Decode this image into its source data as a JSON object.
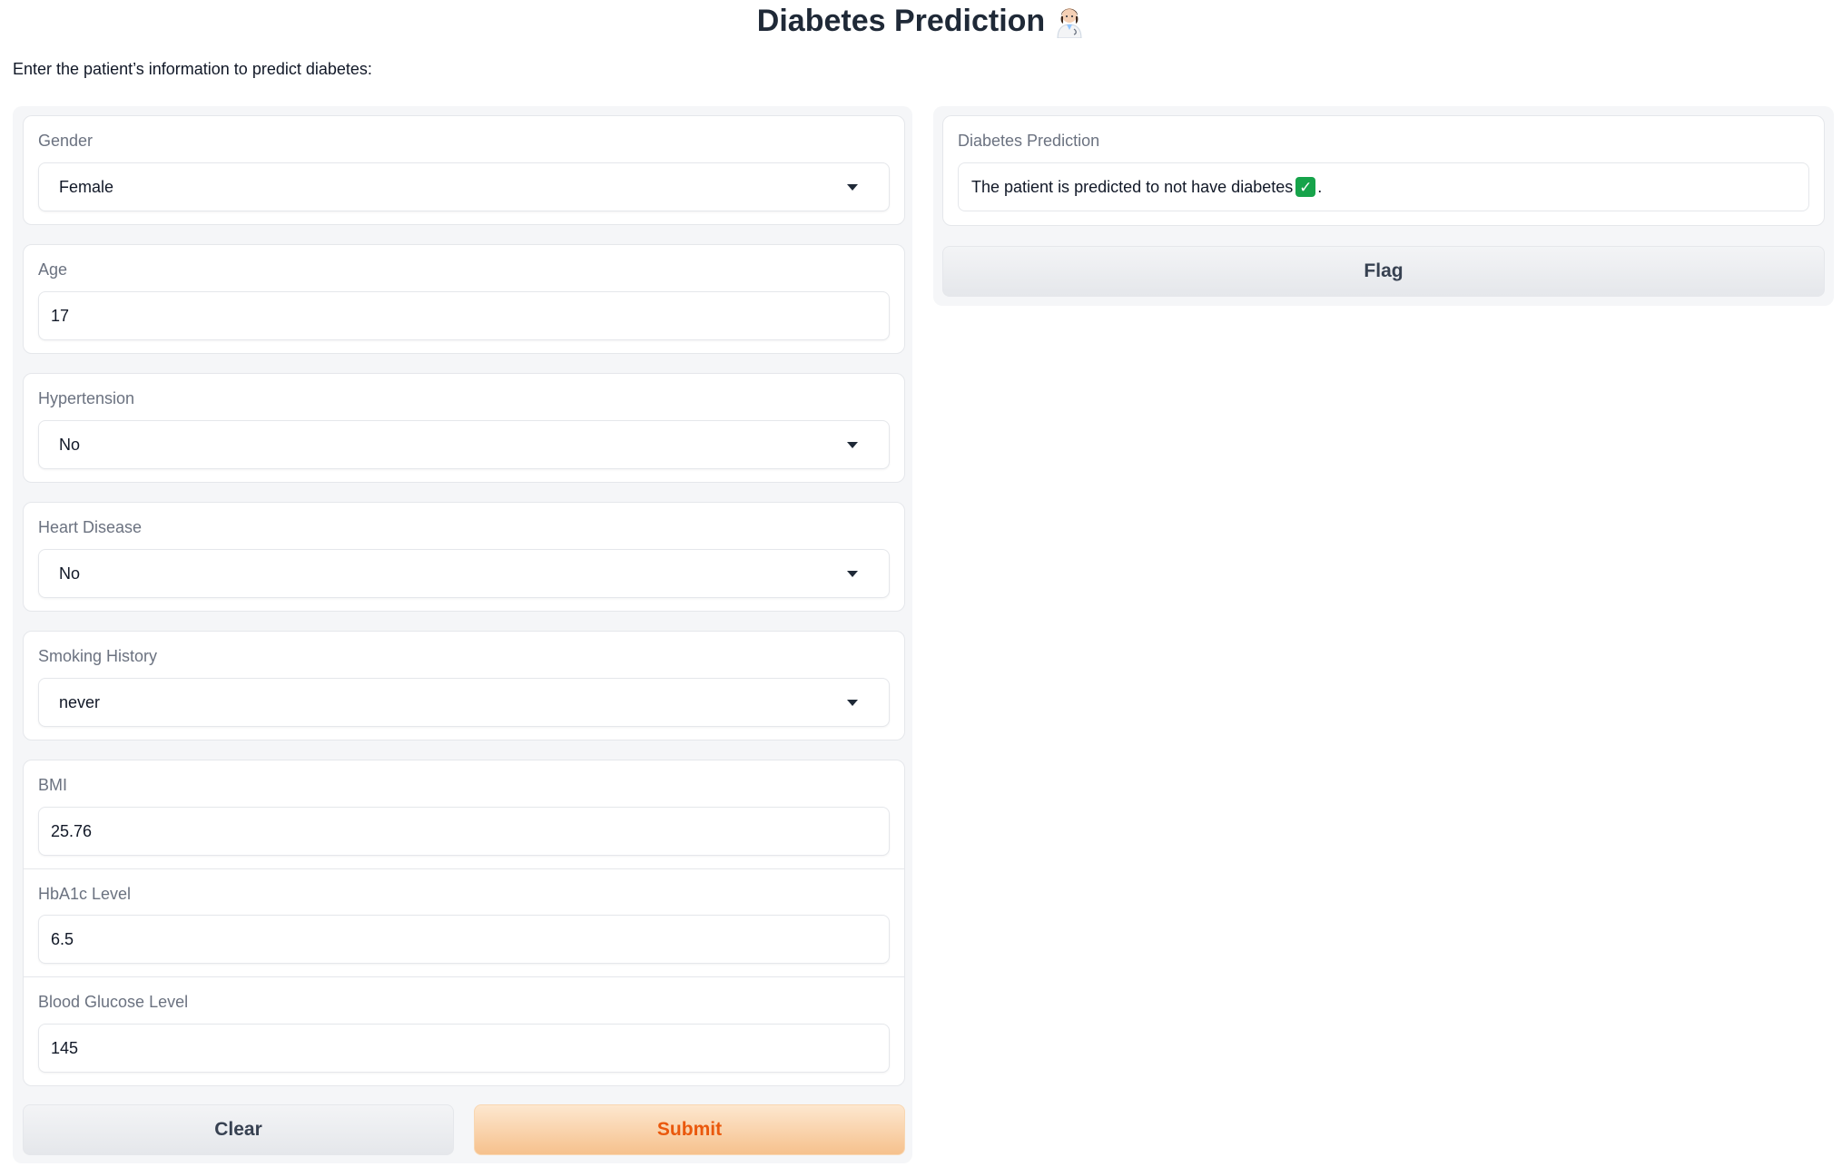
{
  "header": {
    "title": "Diabetes Prediction",
    "title_icon": "woman-health-worker-icon",
    "subtitle": "Enter the patient’s information to predict diabetes:"
  },
  "form": {
    "gender": {
      "label": "Gender",
      "value": "Female"
    },
    "age": {
      "label": "Age",
      "value": "17"
    },
    "hypertension": {
      "label": "Hypertension",
      "value": "No"
    },
    "heart_disease": {
      "label": "Heart Disease",
      "value": "No"
    },
    "smoking_history": {
      "label": "Smoking History",
      "value": "never"
    },
    "bmi": {
      "label": "BMI",
      "value": "25.76"
    },
    "hba1c": {
      "label": "HbA1c Level",
      "value": "6.5"
    },
    "glucose": {
      "label": "Blood Glucose Level",
      "value": "145"
    }
  },
  "actions": {
    "clear_label": "Clear",
    "submit_label": "Submit"
  },
  "output": {
    "label": "Diabetes Prediction",
    "text": "The patient is predicted to not have diabetes",
    "icon": "check-mark-icon",
    "suffix": ".",
    "flag_label": "Flag"
  },
  "colors": {
    "submit_text": "#ea580c",
    "check_icon": "#16a34a",
    "panel_bg": "#f5f6f8"
  }
}
